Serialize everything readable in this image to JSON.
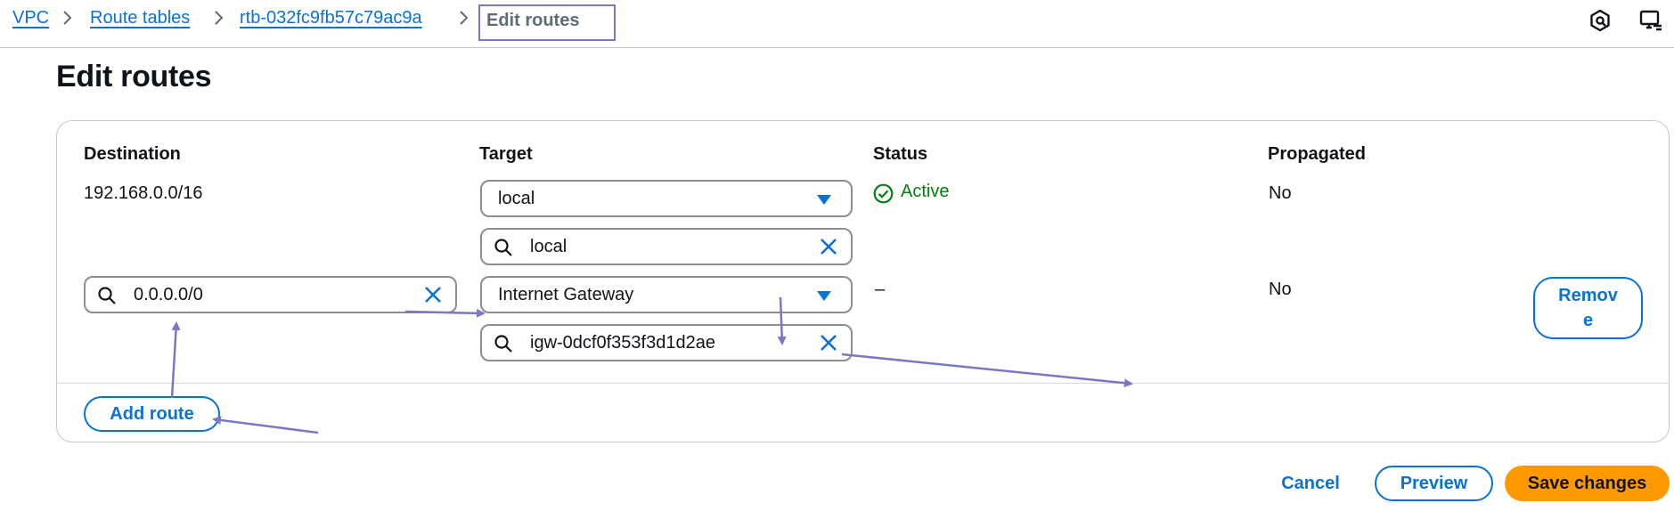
{
  "breadcrumb": {
    "items": [
      "VPC",
      "Route tables",
      "rtb-032fc9fb57c79ac9a"
    ],
    "current": "Edit routes"
  },
  "topbar": {
    "icons": [
      "settings-hex-icon",
      "screen-feedback-icon"
    ]
  },
  "page": {
    "title": "Edit routes"
  },
  "table": {
    "headers": {
      "destination": "Destination",
      "target": "Target",
      "status": "Status",
      "propagated": "Propagated"
    },
    "rows": [
      {
        "destination": "192.168.0.0/16",
        "target_type": "local",
        "target_value": "local",
        "status": "Active",
        "propagated": "No"
      },
      {
        "destination": "0.0.0.0/0",
        "target_type": "Internet Gateway",
        "target_value": "igw-0dcf0f353f3d1d2ae",
        "status": "–",
        "propagated": "No",
        "remove_line1": "Remov",
        "remove_line2": "e"
      }
    ]
  },
  "actions": {
    "add_route": "Add route",
    "cancel": "Cancel",
    "preview": "Preview",
    "save": "Save changes"
  },
  "colors": {
    "link": "#0972d3",
    "primary_button": "#ff9900",
    "status_success": "#037f0c",
    "annotation": "#7a78c2"
  }
}
